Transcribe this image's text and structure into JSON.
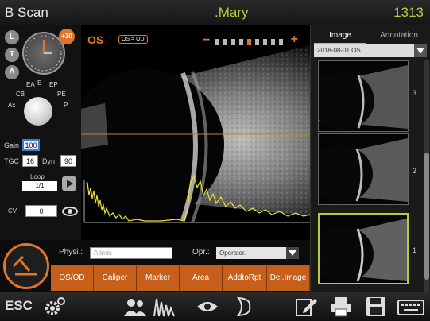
{
  "header": {
    "app_title": "B Scan",
    "patient_name": ".Mary",
    "patient_id": "1313"
  },
  "left_panel": {
    "round_buttons": [
      "L",
      "T",
      "A"
    ],
    "clock_badge": "+30",
    "dial_labels": [
      "EA",
      "E",
      "EP",
      "CB",
      "PE",
      "Ax",
      "P"
    ],
    "gain": {
      "label": "Gain",
      "value": "100"
    },
    "tgc": {
      "label": "TGC",
      "value": "16"
    },
    "dyn": {
      "label": "Dyn",
      "value": "90"
    },
    "loop": {
      "label": "Loop",
      "value": "1/1"
    },
    "cv": {
      "label": "CV",
      "value": "0"
    }
  },
  "scan": {
    "eye_label": "OS",
    "os_od_badge": "OS = OD",
    "gain_minus": "−",
    "gain_plus": "+",
    "gain_level_fraction": 0.6
  },
  "right_panel": {
    "tabs": [
      "Image",
      "Annotation"
    ],
    "date_select": "2018-08-01 OS",
    "thumbnails": [
      {
        "num": "3"
      },
      {
        "num": "2"
      },
      {
        "num": "1"
      }
    ]
  },
  "bottom": {
    "physi_label": "Physi.:",
    "physi_value": "Admin",
    "opr_label": "Opr.:",
    "opr_value": "Operator.",
    "actions": [
      "OS/OD",
      "Caliper",
      "Marker",
      "Area",
      "AddtoRpt",
      "Del.Image"
    ]
  },
  "toolbar": {
    "esc_label": "ESC",
    "icons": [
      "gear-icon",
      "patients-icon",
      "waveform-icon",
      "eye-icon",
      "cornea-icon",
      "edit-icon",
      "print-icon",
      "save-icon",
      "keyboard-icon"
    ]
  },
  "colors": {
    "accent": "#e0752a",
    "highlight": "#b9c93a",
    "trace": "#e8e23a"
  }
}
